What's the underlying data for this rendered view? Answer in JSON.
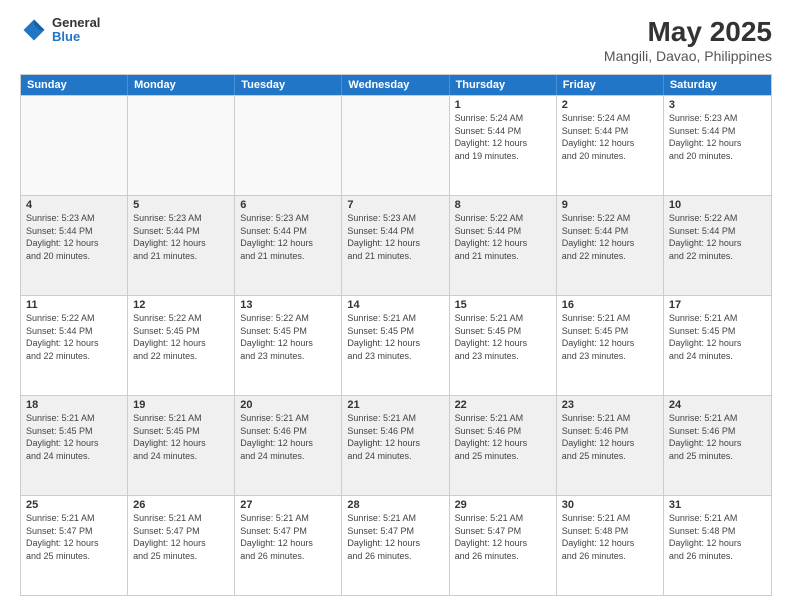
{
  "logo": {
    "general": "General",
    "blue": "Blue"
  },
  "title": "May 2025",
  "subtitle": "Mangili, Davao, Philippines",
  "days": [
    "Sunday",
    "Monday",
    "Tuesday",
    "Wednesday",
    "Thursday",
    "Friday",
    "Saturday"
  ],
  "weeks": [
    [
      {
        "day": "",
        "info": ""
      },
      {
        "day": "",
        "info": ""
      },
      {
        "day": "",
        "info": ""
      },
      {
        "day": "",
        "info": ""
      },
      {
        "day": "1",
        "info": "Sunrise: 5:24 AM\nSunset: 5:44 PM\nDaylight: 12 hours\nand 19 minutes."
      },
      {
        "day": "2",
        "info": "Sunrise: 5:24 AM\nSunset: 5:44 PM\nDaylight: 12 hours\nand 20 minutes."
      },
      {
        "day": "3",
        "info": "Sunrise: 5:23 AM\nSunset: 5:44 PM\nDaylight: 12 hours\nand 20 minutes."
      }
    ],
    [
      {
        "day": "4",
        "info": "Sunrise: 5:23 AM\nSunset: 5:44 PM\nDaylight: 12 hours\nand 20 minutes."
      },
      {
        "day": "5",
        "info": "Sunrise: 5:23 AM\nSunset: 5:44 PM\nDaylight: 12 hours\nand 21 minutes."
      },
      {
        "day": "6",
        "info": "Sunrise: 5:23 AM\nSunset: 5:44 PM\nDaylight: 12 hours\nand 21 minutes."
      },
      {
        "day": "7",
        "info": "Sunrise: 5:23 AM\nSunset: 5:44 PM\nDaylight: 12 hours\nand 21 minutes."
      },
      {
        "day": "8",
        "info": "Sunrise: 5:22 AM\nSunset: 5:44 PM\nDaylight: 12 hours\nand 21 minutes."
      },
      {
        "day": "9",
        "info": "Sunrise: 5:22 AM\nSunset: 5:44 PM\nDaylight: 12 hours\nand 22 minutes."
      },
      {
        "day": "10",
        "info": "Sunrise: 5:22 AM\nSunset: 5:44 PM\nDaylight: 12 hours\nand 22 minutes."
      }
    ],
    [
      {
        "day": "11",
        "info": "Sunrise: 5:22 AM\nSunset: 5:44 PM\nDaylight: 12 hours\nand 22 minutes."
      },
      {
        "day": "12",
        "info": "Sunrise: 5:22 AM\nSunset: 5:45 PM\nDaylight: 12 hours\nand 22 minutes."
      },
      {
        "day": "13",
        "info": "Sunrise: 5:22 AM\nSunset: 5:45 PM\nDaylight: 12 hours\nand 23 minutes."
      },
      {
        "day": "14",
        "info": "Sunrise: 5:21 AM\nSunset: 5:45 PM\nDaylight: 12 hours\nand 23 minutes."
      },
      {
        "day": "15",
        "info": "Sunrise: 5:21 AM\nSunset: 5:45 PM\nDaylight: 12 hours\nand 23 minutes."
      },
      {
        "day": "16",
        "info": "Sunrise: 5:21 AM\nSunset: 5:45 PM\nDaylight: 12 hours\nand 23 minutes."
      },
      {
        "day": "17",
        "info": "Sunrise: 5:21 AM\nSunset: 5:45 PM\nDaylight: 12 hours\nand 24 minutes."
      }
    ],
    [
      {
        "day": "18",
        "info": "Sunrise: 5:21 AM\nSunset: 5:45 PM\nDaylight: 12 hours\nand 24 minutes."
      },
      {
        "day": "19",
        "info": "Sunrise: 5:21 AM\nSunset: 5:45 PM\nDaylight: 12 hours\nand 24 minutes."
      },
      {
        "day": "20",
        "info": "Sunrise: 5:21 AM\nSunset: 5:46 PM\nDaylight: 12 hours\nand 24 minutes."
      },
      {
        "day": "21",
        "info": "Sunrise: 5:21 AM\nSunset: 5:46 PM\nDaylight: 12 hours\nand 24 minutes."
      },
      {
        "day": "22",
        "info": "Sunrise: 5:21 AM\nSunset: 5:46 PM\nDaylight: 12 hours\nand 25 minutes."
      },
      {
        "day": "23",
        "info": "Sunrise: 5:21 AM\nSunset: 5:46 PM\nDaylight: 12 hours\nand 25 minutes."
      },
      {
        "day": "24",
        "info": "Sunrise: 5:21 AM\nSunset: 5:46 PM\nDaylight: 12 hours\nand 25 minutes."
      }
    ],
    [
      {
        "day": "25",
        "info": "Sunrise: 5:21 AM\nSunset: 5:47 PM\nDaylight: 12 hours\nand 25 minutes."
      },
      {
        "day": "26",
        "info": "Sunrise: 5:21 AM\nSunset: 5:47 PM\nDaylight: 12 hours\nand 25 minutes."
      },
      {
        "day": "27",
        "info": "Sunrise: 5:21 AM\nSunset: 5:47 PM\nDaylight: 12 hours\nand 26 minutes."
      },
      {
        "day": "28",
        "info": "Sunrise: 5:21 AM\nSunset: 5:47 PM\nDaylight: 12 hours\nand 26 minutes."
      },
      {
        "day": "29",
        "info": "Sunrise: 5:21 AM\nSunset: 5:47 PM\nDaylight: 12 hours\nand 26 minutes."
      },
      {
        "day": "30",
        "info": "Sunrise: 5:21 AM\nSunset: 5:48 PM\nDaylight: 12 hours\nand 26 minutes."
      },
      {
        "day": "31",
        "info": "Sunrise: 5:21 AM\nSunset: 5:48 PM\nDaylight: 12 hours\nand 26 minutes."
      }
    ]
  ]
}
